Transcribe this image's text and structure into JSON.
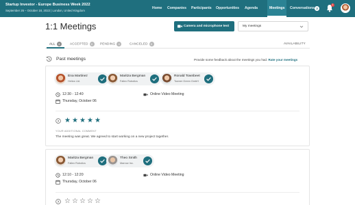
{
  "colors": {
    "brand": "#1f6f7e",
    "brand_active": "#2b8394",
    "star": "#1f6f7e",
    "badge": "#e64545"
  },
  "header": {
    "event_title": "Startup Investor - Europe Business Week 2022",
    "event_subtitle": "September 26 – October 18, 2022 | London, United Kingdom",
    "nav": {
      "home": "Home",
      "companies": "Companies",
      "participants": "Participants",
      "opportunities": "Opportunities",
      "agenda": "Agenda",
      "meetings": "Meetings",
      "conversations": "Conversations"
    },
    "conversations_count": "3",
    "notifications_count": "1",
    "bell_icon": "bell-icon",
    "avatar_icon": "user-avatar"
  },
  "page": {
    "title": "1:1 Meetings",
    "camera_button": "Camera and microphone test",
    "filter_value": "My meetings"
  },
  "tabs": {
    "all": {
      "label": "ALL",
      "count": "3"
    },
    "accepted": {
      "label": "ACCEPTED",
      "count": "0"
    },
    "pending": {
      "label": "PENDING",
      "count": "0"
    },
    "canceled": {
      "label": "CANCELED",
      "count": "0"
    },
    "availability": "AVAILABILITY"
  },
  "past": {
    "title": "Past meetings",
    "feedback_prefix": "Provide some feedback about the meetings you had.",
    "feedback_link": "Rate your meetings"
  },
  "meetings": [
    {
      "participants": [
        {
          "name": "Ena Martinez",
          "company": "Helios Ltd."
        },
        {
          "name": "Maritza Bergman",
          "company": "Fallex Robotics"
        },
        {
          "name": "Ronald Townbeet",
          "company": "Towner Green GmbH"
        }
      ],
      "time": "12:30 - 12:40",
      "date": "Thursday, October 06",
      "location": "Online Video Meeting",
      "rating": 5,
      "comment_label": "YOUR ADDITIONAL COMMENT",
      "comment": "The meeting was great. We agreed to start working on a new project together."
    },
    {
      "participants": [
        {
          "name": "Maritza Bergman",
          "company": "Fallex Robotics"
        },
        {
          "name": "Theo Smith",
          "company": "Marrow Inc."
        }
      ],
      "time": "12:10 - 12:20",
      "date": "Thursday, October 06",
      "location": "Online Video Meeting",
      "rating": 0
    }
  ]
}
